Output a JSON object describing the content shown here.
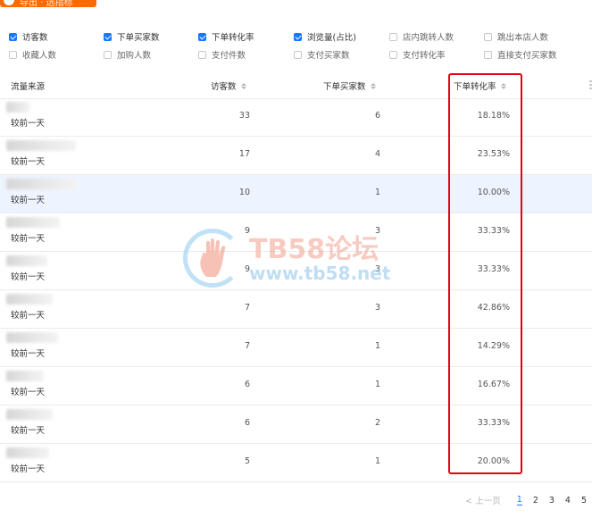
{
  "header": {
    "top_button_label": "导出 · 选指标"
  },
  "filters": [
    {
      "label": "访客数",
      "checked": true
    },
    {
      "label": "下单买家数",
      "checked": true
    },
    {
      "label": "下单转化率",
      "checked": true
    },
    {
      "label": "浏览量(占比)",
      "checked": true
    },
    {
      "label": "店内跳转人数",
      "checked": false
    },
    {
      "label": "跳出本店人数",
      "checked": false
    },
    {
      "label": "收藏人数",
      "checked": false
    },
    {
      "label": "加购人数",
      "checked": false
    },
    {
      "label": "支付件数",
      "checked": false
    },
    {
      "label": "支付买家数",
      "checked": false
    },
    {
      "label": "支付转化率",
      "checked": false
    },
    {
      "label": "直接支付买家数",
      "checked": false
    }
  ],
  "table": {
    "columns": [
      "流量来源",
      "访客数",
      "下单买家数",
      "下单转化率"
    ],
    "rows": [
      {
        "sub": "较前一天",
        "visitors": "33",
        "buyers": "6",
        "rate": "18.18%"
      },
      {
        "sub": "较前一天",
        "visitors": "17",
        "buyers": "4",
        "rate": "23.53%"
      },
      {
        "sub": "较前一天",
        "visitors": "10",
        "buyers": "1",
        "rate": "10.00%"
      },
      {
        "sub": "较前一天",
        "visitors": "9",
        "buyers": "3",
        "rate": "33.33%"
      },
      {
        "sub": "较前一天",
        "visitors": "9",
        "buyers": "3",
        "rate": "33.33%"
      },
      {
        "sub": "较前一天",
        "visitors": "7",
        "buyers": "3",
        "rate": "42.86%"
      },
      {
        "sub": "较前一天",
        "visitors": "7",
        "buyers": "1",
        "rate": "14.29%"
      },
      {
        "sub": "较前一天",
        "visitors": "6",
        "buyers": "1",
        "rate": "16.67%"
      },
      {
        "sub": "较前一天",
        "visitors": "6",
        "buyers": "2",
        "rate": "33.33%"
      },
      {
        "sub": "较前一天",
        "visitors": "5",
        "buyers": "1",
        "rate": "20.00%"
      }
    ]
  },
  "watermark": {
    "title": "TB58论坛",
    "url": "www.tb58.net"
  },
  "pagination": {
    "prev_label": "< 上一页",
    "pages": [
      "1",
      "2",
      "3",
      "4",
      "5"
    ],
    "current": "1"
  },
  "colors": {
    "accent": "#1677ff",
    "highlight_box": "#e60012",
    "brand": "#ff6a00",
    "row_highlight": "#eef4ff"
  }
}
